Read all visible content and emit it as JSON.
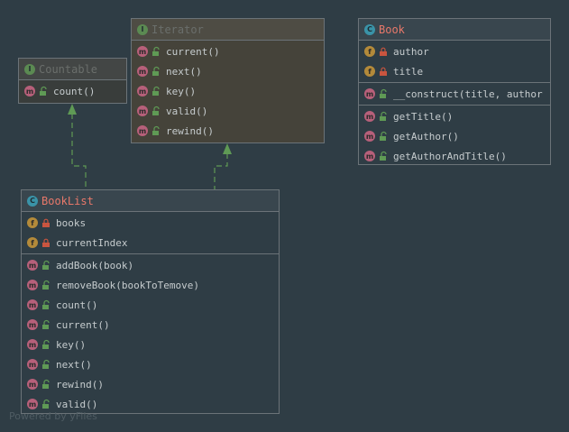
{
  "nodes": {
    "iterator": {
      "title": "Iterator",
      "kind_letter": "I",
      "methods": [
        {
          "badge": "m",
          "label": "current()"
        },
        {
          "badge": "m",
          "label": "next()"
        },
        {
          "badge": "m",
          "label": "key()"
        },
        {
          "badge": "m",
          "label": "valid()"
        },
        {
          "badge": "m",
          "label": "rewind()"
        }
      ]
    },
    "countable": {
      "title": "Countable",
      "kind_letter": "I",
      "methods": [
        {
          "badge": "m",
          "label": "count()"
        }
      ]
    },
    "book": {
      "title": "Book",
      "kind_letter": "C",
      "fields": [
        {
          "badge": "f",
          "label": "author"
        },
        {
          "badge": "f",
          "label": "title"
        }
      ],
      "constructor": [
        {
          "badge": "m",
          "label": "__construct(title, author"
        }
      ],
      "methods": [
        {
          "badge": "m",
          "label": "getTitle()"
        },
        {
          "badge": "m",
          "label": "getAuthor()"
        },
        {
          "badge": "m",
          "label": "getAuthorAndTitle()"
        }
      ]
    },
    "booklist": {
      "title": "BookList",
      "kind_letter": "C",
      "fields": [
        {
          "badge": "f",
          "label": "books"
        },
        {
          "badge": "f",
          "label": "currentIndex"
        }
      ],
      "methods": [
        {
          "badge": "m",
          "label": "addBook(book)"
        },
        {
          "badge": "m",
          "label": "removeBook(bookToTemove)"
        },
        {
          "badge": "m",
          "label": "count()"
        },
        {
          "badge": "m",
          "label": "current()"
        },
        {
          "badge": "m",
          "label": "key()"
        },
        {
          "badge": "m",
          "label": "next()"
        },
        {
          "badge": "m",
          "label": "rewind()"
        },
        {
          "badge": "m",
          "label": "valid()"
        }
      ]
    }
  },
  "relations": [
    {
      "from": "BookList",
      "to": "Countable",
      "type": "implements"
    },
    {
      "from": "BookList",
      "to": "Iterator",
      "type": "implements"
    }
  ],
  "icons": {
    "method": "method-badge-icon",
    "field": "field-badge-icon",
    "public": "unlock-icon",
    "private": "lock-icon"
  },
  "colors": {
    "background": "#2f3d45",
    "class_title": "#e8786a",
    "relation": "#5f9a55",
    "method_badge": "#b7607a",
    "field_badge": "#b38a3a",
    "class_badge": "#3a93a8",
    "interface_badge": "#5b8a52"
  },
  "watermark": "Powered by yFiles"
}
